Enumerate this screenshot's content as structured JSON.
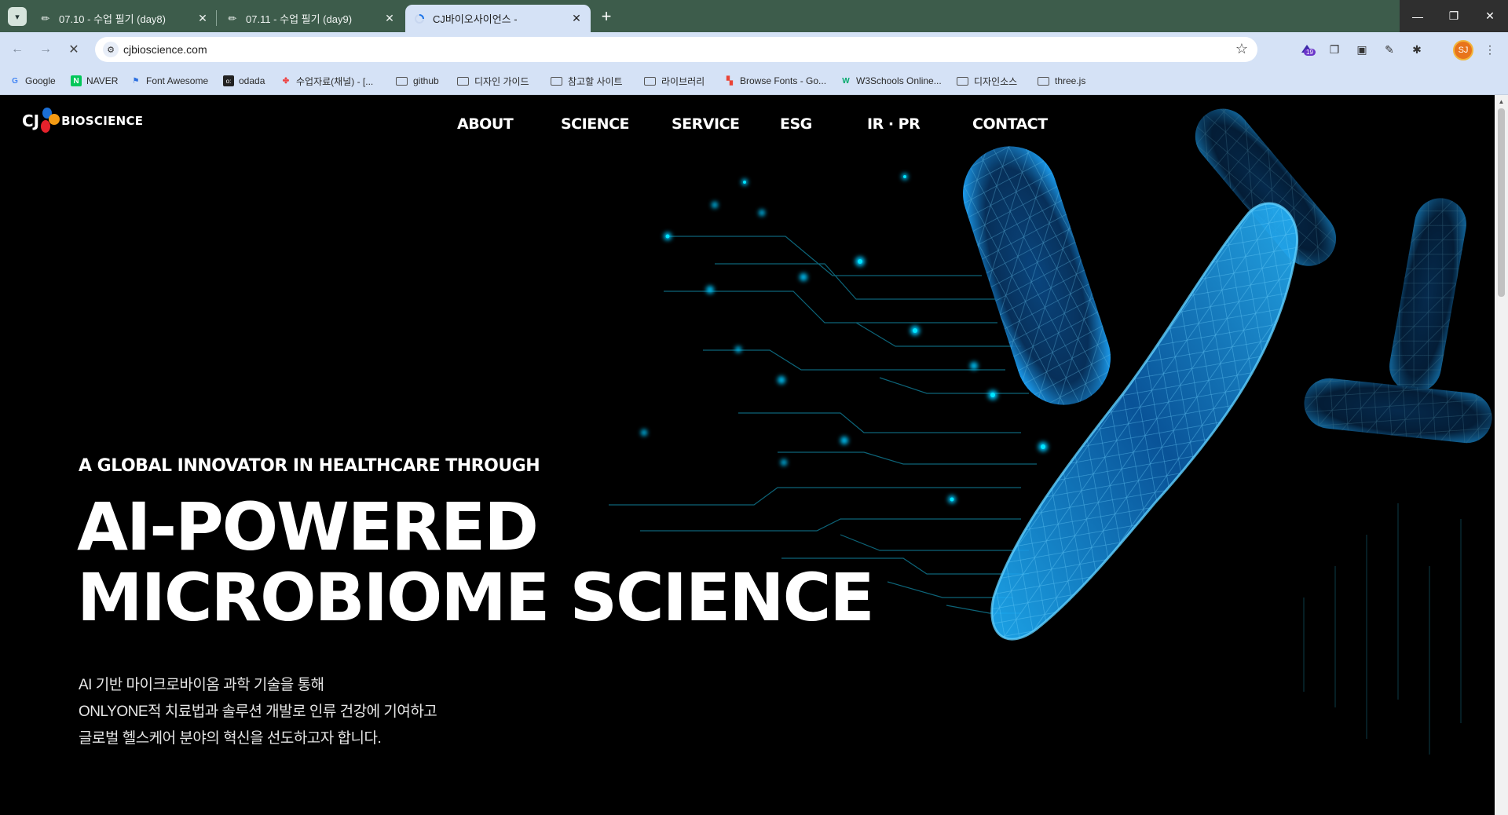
{
  "browser": {
    "tabs": [
      {
        "title": "07.10 - 수업 필기 (day8)",
        "favicon": "pencil-icon",
        "active": false
      },
      {
        "title": "07.11 - 수업 필기 (day9)",
        "favicon": "pencil-icon",
        "active": false
      },
      {
        "title": "CJ바이오사이언스 -",
        "favicon": "loading-spinner-icon",
        "active": true
      }
    ],
    "url": "cjbioscience.com",
    "extension_badge": "19",
    "profile_initials": "SJ",
    "bookmarks": [
      {
        "label": "Google",
        "icon": "google-icon"
      },
      {
        "label": "NAVER",
        "icon": "naver-icon"
      },
      {
        "label": "Font Awesome",
        "icon": "flag-icon"
      },
      {
        "label": "odada",
        "icon": "odada-icon"
      },
      {
        "label": "수업자료(채널) - [...",
        "icon": "figma-icon"
      },
      {
        "label": "github",
        "icon": "folder-icon"
      },
      {
        "label": "디자인 가이드",
        "icon": "folder-icon"
      },
      {
        "label": "참고할 사이트",
        "icon": "folder-icon"
      },
      {
        "label": "라이브러리",
        "icon": "folder-icon"
      },
      {
        "label": "Browse Fonts - Go...",
        "icon": "google-fonts-icon"
      },
      {
        "label": "W3Schools Online...",
        "icon": "w3schools-icon"
      },
      {
        "label": "디자인소스",
        "icon": "folder-icon"
      },
      {
        "label": "three.js",
        "icon": "folder-icon"
      }
    ]
  },
  "site": {
    "logo": {
      "mark": "CJ",
      "name": "BIOSCIENCE"
    },
    "nav": [
      "ABOUT",
      "SCIENCE",
      "SERVICE",
      "ESG",
      "IR · PR",
      "CONTACT"
    ],
    "hero": {
      "subtitle": "A GLOBAL INNOVATOR IN HEALTHCARE THROUGH",
      "title_line1": "AI-POWERED",
      "title_line2": "MICROBIOME SCIENCE",
      "desc": [
        "AI 기반 마이크로바이옴 과학 기술을 통해",
        "ONLYONE적 치료법과 솔루션 개발로 인류 건강에 기여하고",
        "글로벌 헬스케어 분야의 혁신을 선도하고자 합니다."
      ]
    },
    "colors": {
      "accent": "#1ea7ff",
      "glow": "#00d4ff",
      "background": "#000000"
    }
  }
}
